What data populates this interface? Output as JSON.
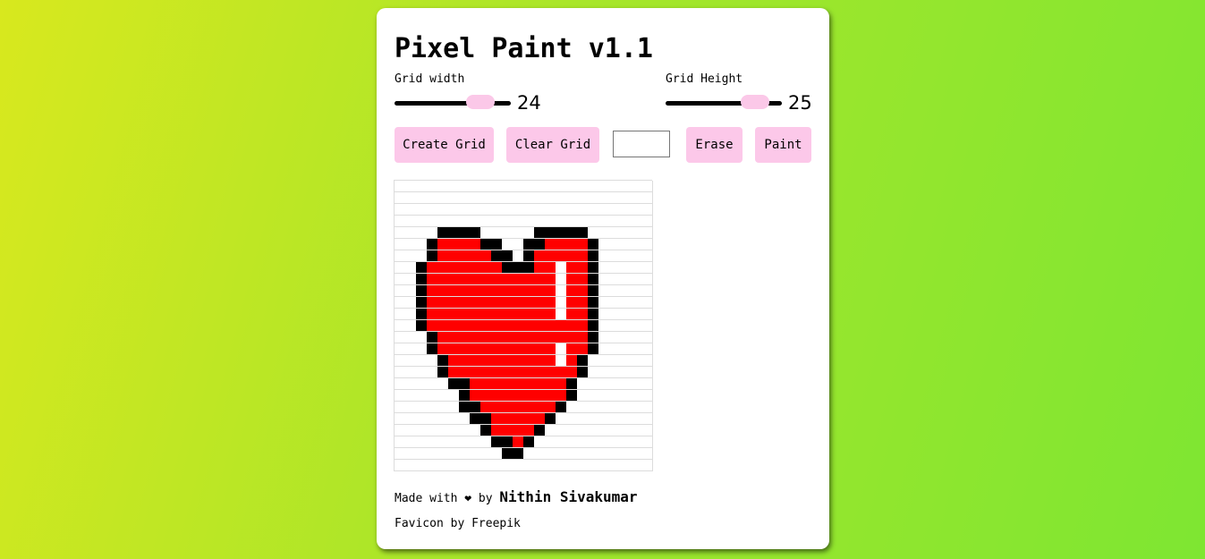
{
  "app": {
    "title": "Pixel Paint v1.1"
  },
  "sliders": {
    "width": {
      "label": "Grid width",
      "value": "24",
      "fraction": 0.82
    },
    "height": {
      "label": "Grid Height",
      "value": "25",
      "fraction": 0.86
    }
  },
  "toolbar": {
    "create_label": "Create Grid",
    "clear_label": "Clear Grid",
    "color_value": "#ffffff",
    "erase_label": "Erase",
    "paint_label": "Paint"
  },
  "colors": {
    "thumb": "#fbc8e8",
    "button": "#fcc8e9",
    "paint_red": "#ff0000",
    "paint_black": "#000000"
  },
  "canvas": {
    "columns": 24,
    "rows": 25,
    "legend": {
      ".": "empty",
      "k": "black",
      "r": "red"
    },
    "pixels": [
      "........................",
      "........................",
      "........................",
      "........................",
      "....kkkk.....kkkkk......",
      "...krrrrkk..kkrrrrk.....",
      "...krrrrrkk.krrrrrk.....",
      "..krrrrrrrkkkrr.rrk.....",
      "..krrrrrrrrrrrr.rrk.....",
      "..krrrrrrrrrrrr.rrk.....",
      "..krrrrrrrrrrrr.rrk.....",
      "..krrrrrrrrrrrr.rrk.....",
      "..krrrrrrrrrrrrrrrk.....",
      "...krrrrrrrrrrrrrrk.....",
      "...krrrrrrrrrrr.rrk.....",
      "....krrrrrrrrrr.rk......",
      "....krrrrrrrrrrrrk......",
      ".....kkrrrrrrrrrk.......",
      "......krrrrrrrrrk.......",
      "......kkrrrrrrrk........",
      ".......kkrrrrrk.........",
      "........krrrrk..........",
      ".........kkrk...........",
      "..........kk............",
      "........................"
    ]
  },
  "footer": {
    "made_with": "Made with ❤ by",
    "author": "Nithin Sivakumar",
    "favicon_credit": "Favicon by Freepik"
  }
}
